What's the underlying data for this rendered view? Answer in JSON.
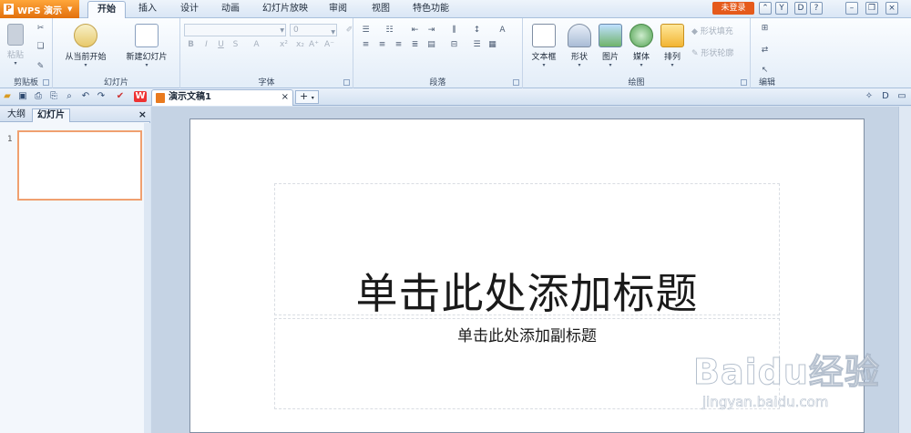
{
  "app_menu": {
    "label": "WPS 演示"
  },
  "tabs": [
    "开始",
    "插入",
    "设计",
    "动画",
    "幻灯片放映",
    "审阅",
    "视图",
    "特色功能"
  ],
  "login": {
    "label": "未登录"
  },
  "ribbon": {
    "clipboard": {
      "group_label": "剪贴板",
      "paste_label": "粘贴"
    },
    "slides": {
      "group_label": "幻灯片",
      "play_label": "从当前开始",
      "new_slide_label": "新建幻灯片"
    },
    "font": {
      "group_label": "字体",
      "font_size": "0"
    },
    "paragraph": {
      "group_label": "段落"
    },
    "drawing": {
      "group_label": "绘图",
      "textbox_label": "文本框",
      "shape_label": "形状",
      "picture_label": "图片",
      "media_label": "媒体",
      "arrange_label": "排列",
      "fill_label": "形状填充",
      "outline_label": "形状轮廓"
    },
    "edit": {
      "group_label": "编辑"
    }
  },
  "document_tab": {
    "title": "演示文稿1",
    "close": "×"
  },
  "new_tab": {
    "label": "+"
  },
  "left_panel": {
    "tabs": [
      "大纲",
      "幻灯片"
    ],
    "close": "×",
    "slide_number": "1"
  },
  "slide": {
    "title_placeholder": "单击此处添加标题",
    "subtitle_placeholder": "单击此处添加副标题"
  },
  "watermark": {
    "brand": "Baidu经验",
    "url": "jingyan.baidu.com"
  }
}
